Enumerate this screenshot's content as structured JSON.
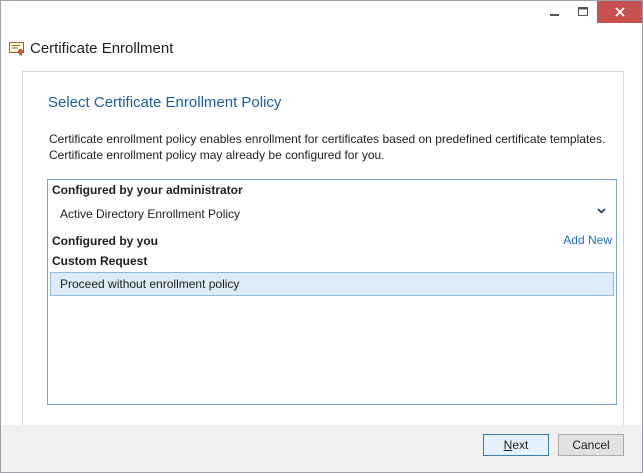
{
  "window": {
    "title": "Certificate Enrollment"
  },
  "page": {
    "heading": "Select Certificate Enrollment Policy",
    "description_line1": "Certificate enrollment policy enables enrollment for certificates based on predefined certificate templates.",
    "description_line2": "Certificate enrollment policy may already be configured for you."
  },
  "policies": {
    "admin_group": "Configured by your administrator",
    "admin_item": "Active Directory Enrollment Policy",
    "user_group": "Configured by you",
    "add_new": "Add New",
    "custom_group": "Custom Request",
    "custom_item": "Proceed without enrollment policy"
  },
  "buttons": {
    "next_first": "N",
    "next_rest": "ext",
    "cancel": "Cancel"
  },
  "icons": {
    "minimize": "minimize-icon",
    "maximize": "maximize-icon",
    "close": "close-icon",
    "app": "certificate-icon",
    "expand": "chevron-down-icon"
  },
  "colors": {
    "accent": "#1a5ea8",
    "link": "#1a6fc4",
    "selection": "#dbecf7",
    "close_button": "#c75050"
  }
}
